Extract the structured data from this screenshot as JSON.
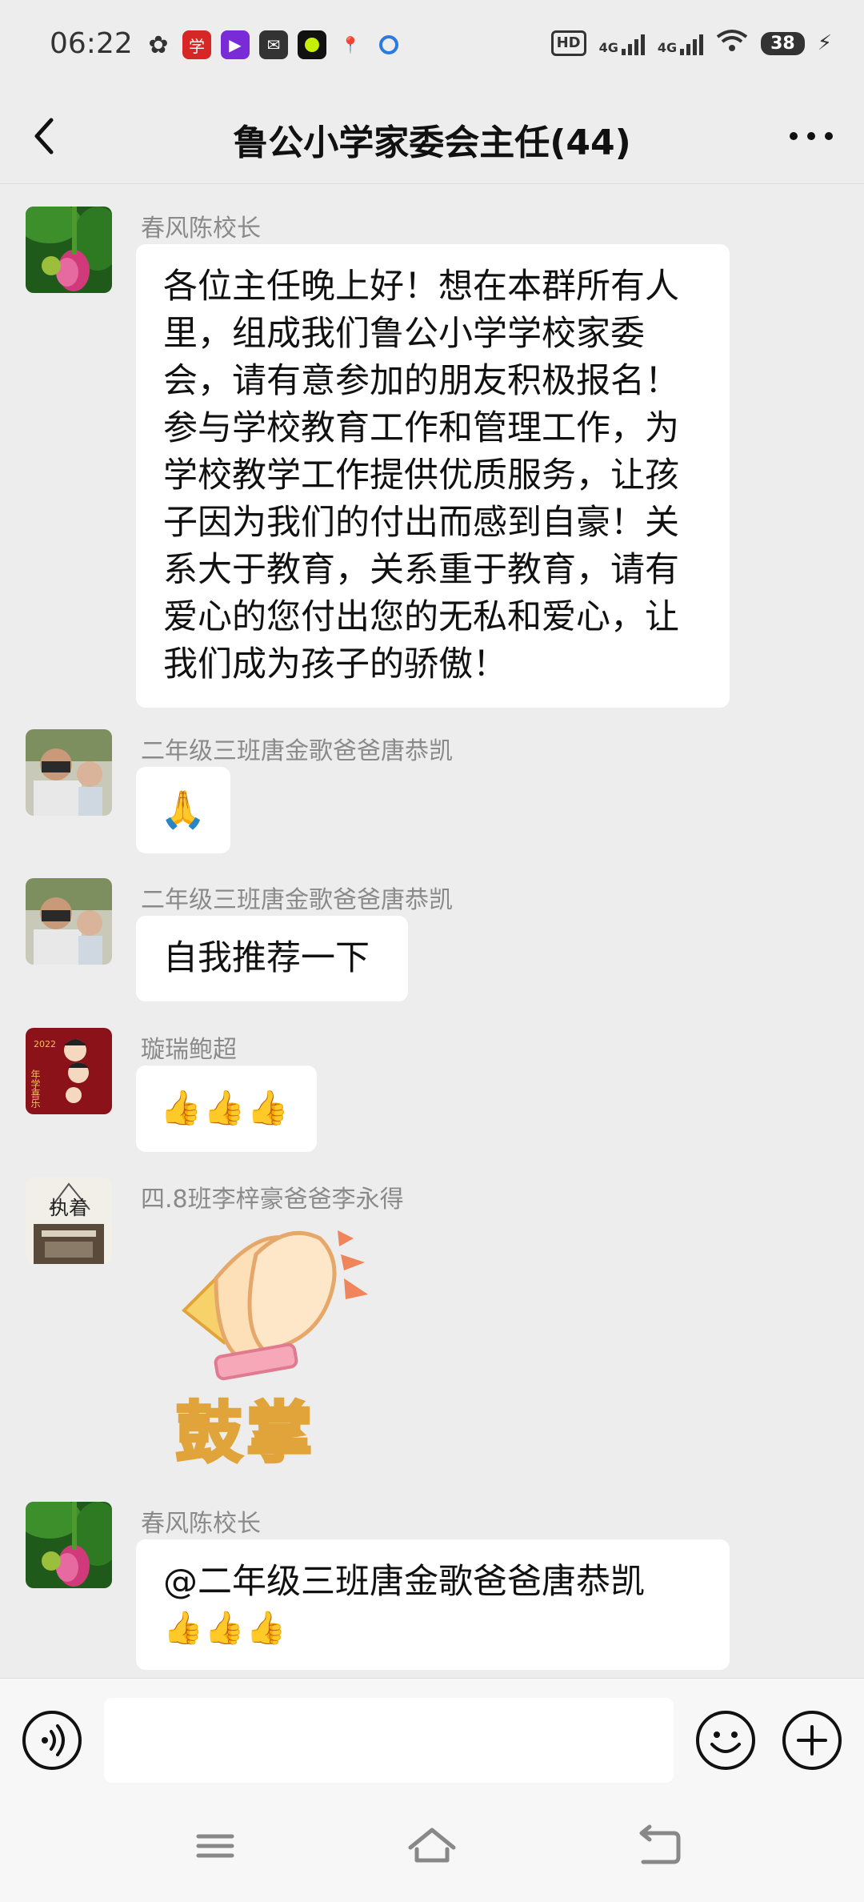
{
  "status_bar": {
    "time": "06:22",
    "hd_label": "HD",
    "net1": "4G",
    "net2": "4G",
    "battery": "38"
  },
  "header": {
    "title": "鲁公小学家委会主任(44)"
  },
  "messages": [
    {
      "sender": "春风陈校长",
      "type": "text",
      "text": "各位主任晚上好！想在本群所有人\n里，组成我们鲁公小学学校家委\n会，请有意参加的朋友积极报名！\n参与学校教育工作和管理工作，为\n学校教学工作提供优质服务，让孩\n子因为我们的付出而感到自豪！关\n系大于教育，关系重于教育，请有\n爱心的您付出您的无私和爱心，让\n我们成为孩子的骄傲！"
    },
    {
      "sender": "二年级三班唐金歌爸爸唐恭凯",
      "type": "emoji",
      "emoji": "🙏"
    },
    {
      "sender": "二年级三班唐金歌爸爸唐恭凯",
      "type": "text",
      "text": "自我推荐一下"
    },
    {
      "sender": "璇瑞鲍超",
      "type": "emoji",
      "emoji": "👍👍👍"
    },
    {
      "sender": "四.8班李梓豪爸爸李永得",
      "type": "sticker",
      "sticker_text": "鼓掌"
    },
    {
      "sender": "春风陈校长",
      "type": "text",
      "text": "@二年级三班唐金歌爸爸唐恭凯",
      "emoji": "👍👍👍"
    }
  ],
  "avatar_texts": {
    "xuanrui_year": "2022",
    "xuanrui_phrase": "年学喜乐",
    "li_chars": "执着"
  },
  "input": {
    "placeholder": ""
  },
  "colors": {
    "background": "#ededed",
    "bubble": "#ffffff",
    "sender_name": "#8a8a8a"
  },
  "icons": {
    "back": "chevron-left-icon",
    "more": "more-dots-icon",
    "voice": "voice-icon",
    "emoji": "smiley-icon",
    "plus": "plus-icon",
    "nav_menu": "menu-icon",
    "nav_home": "home-icon",
    "nav_back": "back-icon"
  }
}
